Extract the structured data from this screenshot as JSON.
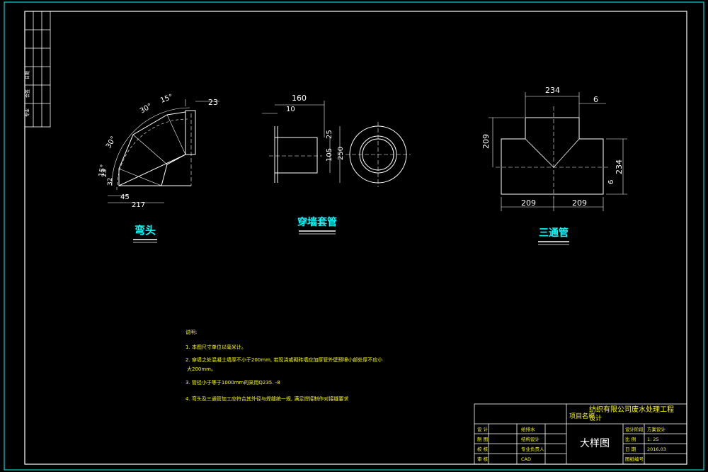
{
  "colors": {
    "background": "#000000",
    "border": "#00ffff",
    "line": "#ffffff",
    "dim": "#ffffff",
    "title": "#00ffff",
    "notes": "#ffff00"
  },
  "side_strip": {
    "labels": [
      "专业",
      "会签",
      "日期"
    ]
  },
  "elbow": {
    "title": "弯头",
    "dims": {
      "angle_top": "15°",
      "angle_30a": "30°",
      "angle_30b": "30°",
      "angle_bottom": "15°",
      "len_23": "23",
      "len_45": "45",
      "len_217": "217",
      "len_32": "32",
      "len_23v": "23"
    }
  },
  "sleeve": {
    "title": "穿墙套管",
    "dims": {
      "len_160": "160",
      "len_10": "10",
      "dia_105": "105",
      "dia_250": "250",
      "len_25": "25"
    }
  },
  "tee": {
    "title": "三通管",
    "dims": {
      "top_234": "234",
      "top_6": "6",
      "left_209": "209",
      "right_234": "234",
      "right_6": "6",
      "bot_209a": "209",
      "bot_209b": "209"
    }
  },
  "notes": {
    "heading": "说明:",
    "items": [
      "1. 本图尺寸单位以毫米计。",
      "2. 穿墙之处混凝土墙厚不小于200mm, 若现浇或砌砖墙应加厚管外壁预埋小部处厚不应小",
      "大200mm。",
      "3. 管径小于等于1000mm的采用Q235. -8",
      "4. 弯头及三通管加工应符合其外径与焊缝统一规, 满足焊接制作对接缝要求"
    ]
  },
  "title_block": {
    "project_label": "项目名称",
    "project_name": "纺织有限公司废水处理工程",
    "project_sub": "设计",
    "drawing_name": "大样图",
    "rows_left": [
      {
        "label": "设 计",
        "value": "给排水"
      },
      {
        "label": "制 图",
        "value": "结构设计"
      },
      {
        "label": "校 核",
        "value": "专业负责人"
      },
      {
        "label": "审 核",
        "value": "CAD"
      }
    ],
    "rows_right": [
      {
        "label": "设计阶段",
        "value": "方案设计"
      },
      {
        "label": "比 例",
        "value": "1: 25"
      },
      {
        "label": "日 期",
        "value": "2016.03"
      },
      {
        "label": "图纸编号",
        "value": ""
      }
    ]
  }
}
